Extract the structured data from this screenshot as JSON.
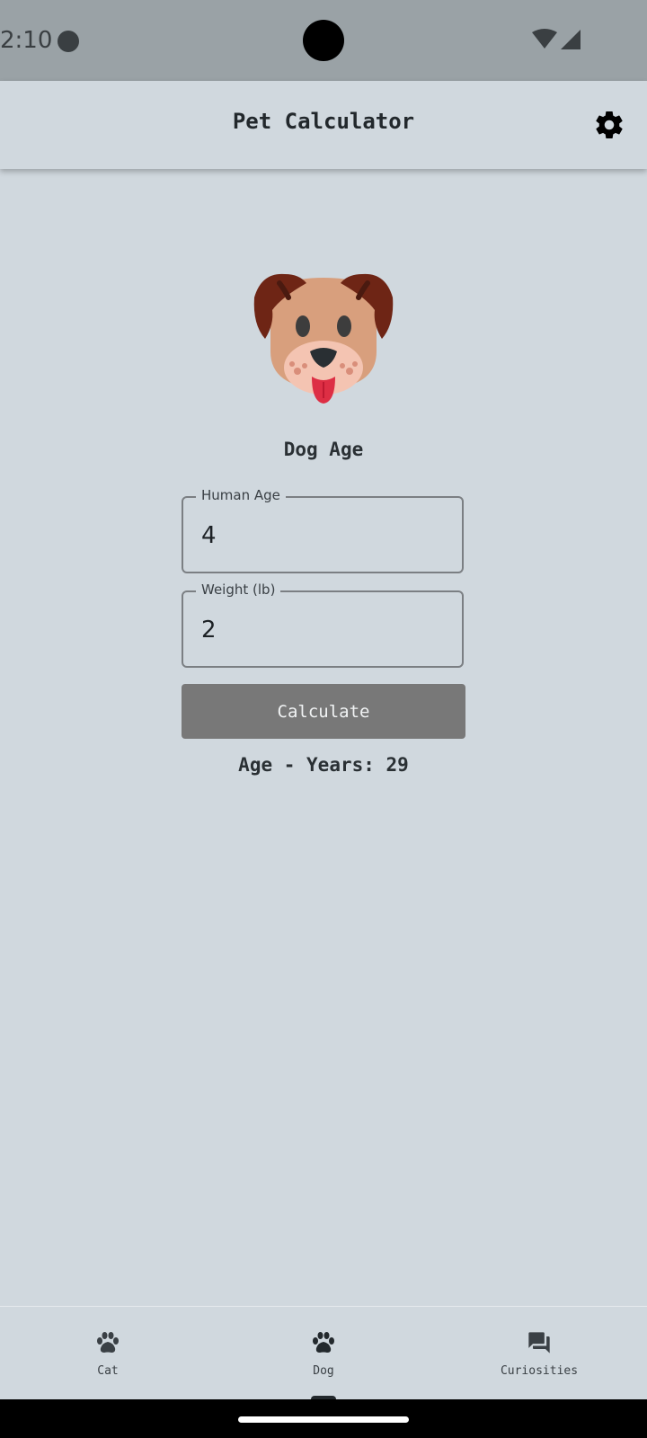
{
  "status_bar": {
    "time": "2:10"
  },
  "app_bar": {
    "title": "Pet Calculator",
    "settings_icon": "gear-icon"
  },
  "main": {
    "image_icon": "dog-face",
    "section_title": "Dog Age",
    "human_age": {
      "label": "Human Age",
      "value": "4"
    },
    "weight": {
      "label": "Weight (lb)",
      "value": "2"
    },
    "calculate_label": "Calculate",
    "result_text": "Age - Years: 29"
  },
  "bottom_nav": {
    "items": [
      {
        "label": "Cat",
        "icon": "paw-icon"
      },
      {
        "label": "Dog",
        "icon": "paw-icon",
        "selected": true
      },
      {
        "label": "Curiosities",
        "icon": "chat-icon"
      }
    ]
  },
  "colors": {
    "background": "#d0d8de",
    "status_bar": "#9aa2a6",
    "button": "#787878",
    "text_dark": "#22282c"
  }
}
